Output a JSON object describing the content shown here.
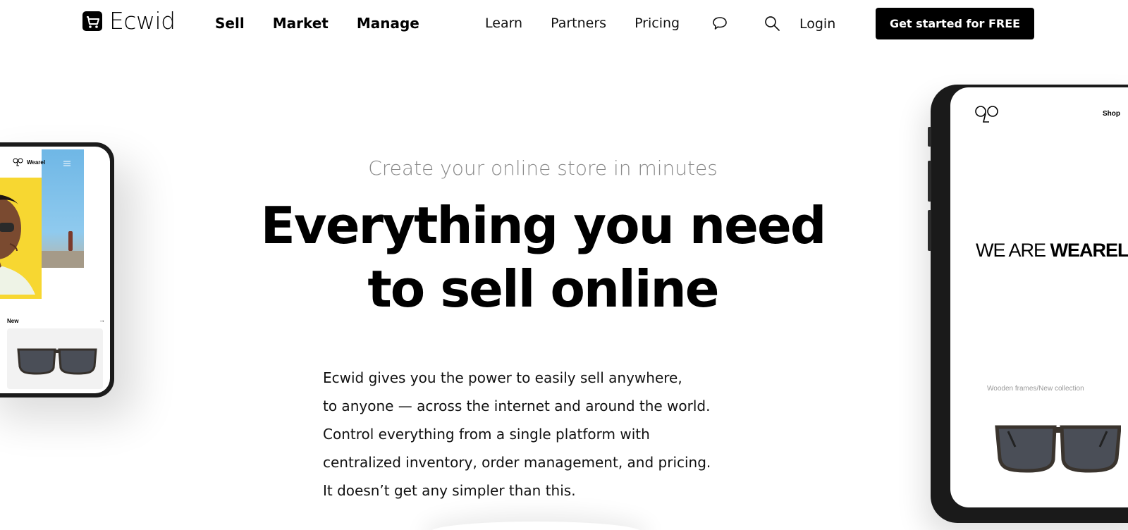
{
  "header": {
    "logo_text": "Ecwid",
    "nav_main": [
      "Sell",
      "Market",
      "Manage"
    ],
    "nav_secondary": [
      "Learn",
      "Partners",
      "Pricing"
    ],
    "chat_icon": "chat-bubble-icon",
    "search_icon": "search-icon",
    "login_label": "Login",
    "cta_label": "Get started for FREE"
  },
  "hero": {
    "subtitle": "Create your online store in minutes",
    "headline_line1": "Everything you need",
    "headline_line2_prefix": "to ",
    "headline_highlight": "sell online",
    "highlight_color": "#ffde00",
    "description": [
      "Ecwid gives you the power to easily sell anywhere,",
      "to anyone — across the internet and around the world.",
      "Control everything from a single platform with",
      "centralized inventory, order management, and pricing.",
      "It doesn’t get any simpler than this."
    ]
  },
  "phone_left": {
    "brand": "Wearel",
    "new_label": "New",
    "arrow": "→"
  },
  "tablet_right": {
    "shop_label": "Shop",
    "headline_light": "WE ARE ",
    "headline_bold": "WEAREL",
    "caption": "Wooden frames/New collection"
  }
}
